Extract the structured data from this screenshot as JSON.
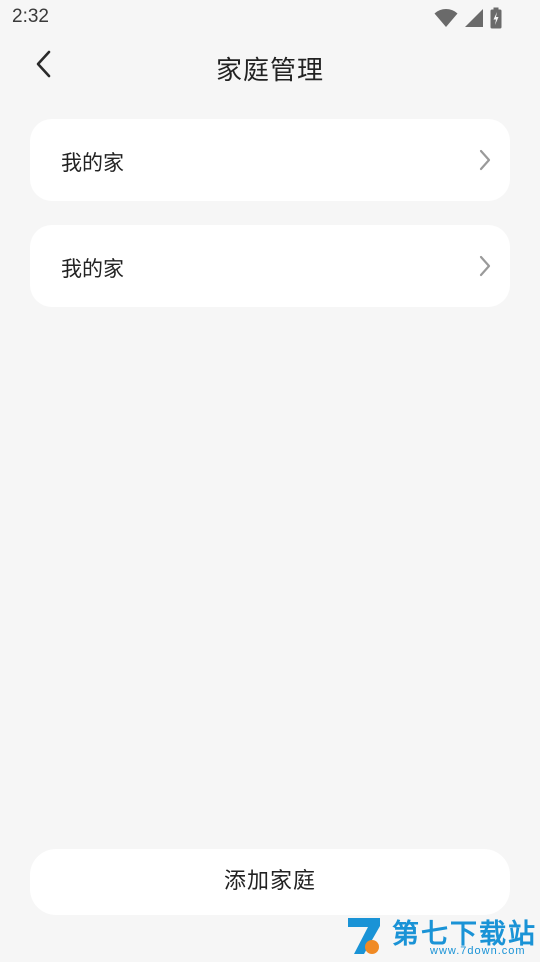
{
  "status_bar": {
    "time": "2:32",
    "icons": [
      "wifi-icon",
      "cell-signal-icon",
      "battery-charging-icon"
    ]
  },
  "nav": {
    "back_icon": "chevron-left-icon",
    "title": "家庭管理"
  },
  "homes": [
    {
      "label": "我的家",
      "icon": "chevron-right-icon"
    },
    {
      "label": "我的家",
      "icon": "chevron-right-icon"
    }
  ],
  "footer": {
    "add_label": "添加家庭"
  },
  "watermark": {
    "text": "第七下载站",
    "url": "www.7down.com",
    "color": "#1a93d6"
  },
  "colors": {
    "background": "#f6f6f6",
    "card": "#ffffff",
    "text": "#222222",
    "chevron": "#9a9a9a"
  }
}
